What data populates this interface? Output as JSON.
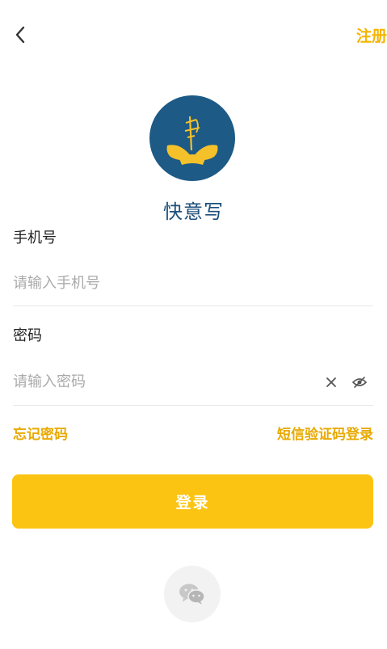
{
  "header": {
    "back_icon": "chevron-left-icon",
    "register_label": "注册"
  },
  "brand": {
    "logo_icon": "app-logo",
    "app_name": "快意写",
    "logo_bg": "#1d5a86",
    "logo_accent": "#f5c12a"
  },
  "form": {
    "phone_label": "手机号",
    "phone_placeholder": "请输入手机号",
    "password_label": "密码",
    "password_placeholder": "请输入密码",
    "clear_icon": "close-icon",
    "visibility_icon": "eye-off-icon"
  },
  "links": {
    "forgot_password": "忘记密码",
    "sms_login": "短信验证码登录"
  },
  "actions": {
    "login_label": "登录",
    "accent_color": "#fbc412",
    "wechat_icon": "wechat-icon"
  }
}
